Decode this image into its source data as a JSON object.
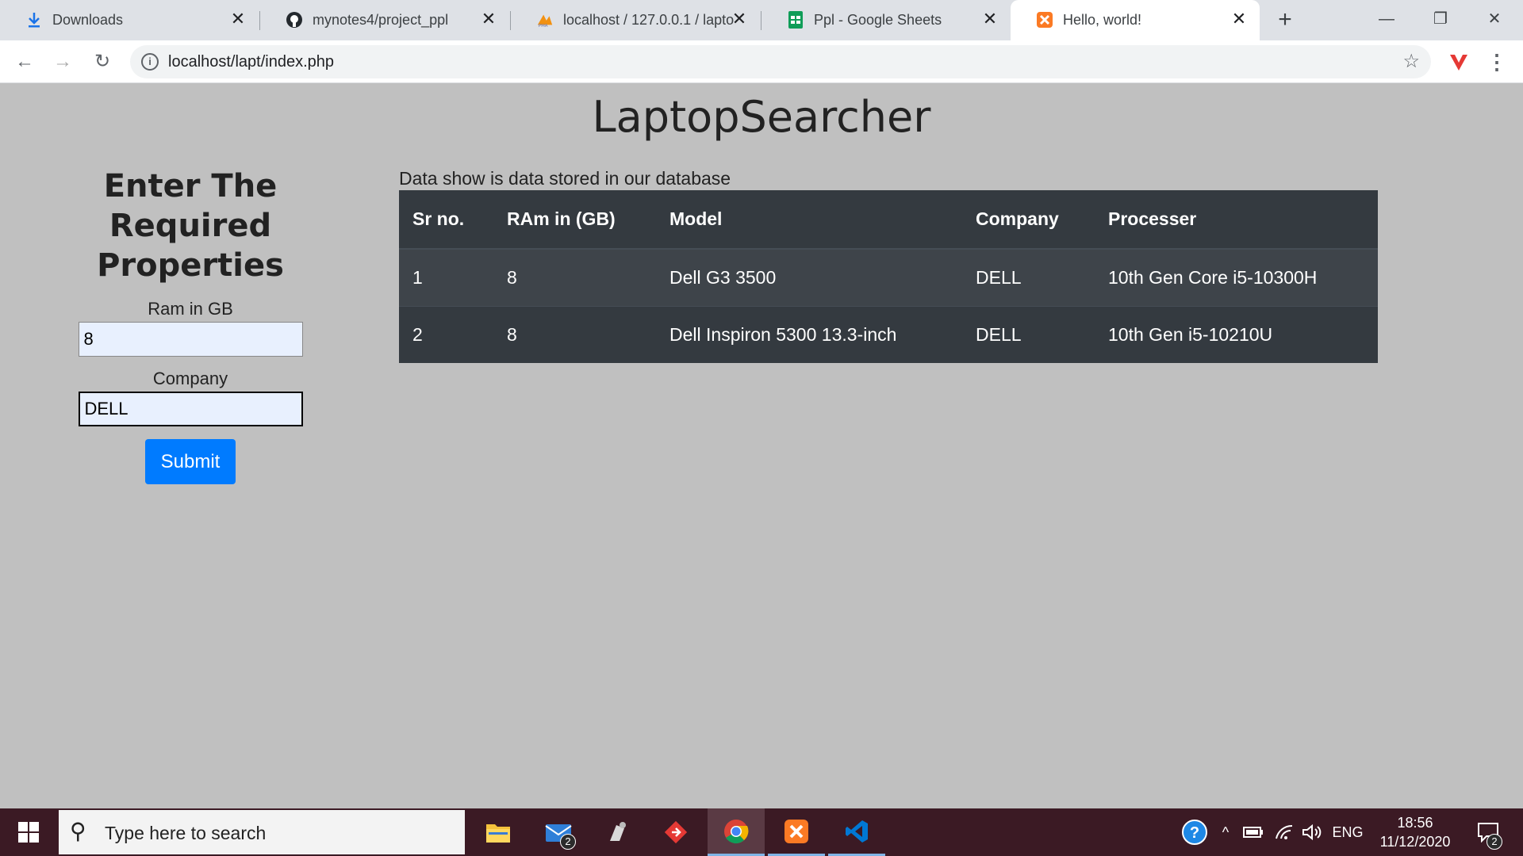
{
  "browser": {
    "tabs": [
      {
        "title": "Downloads",
        "icon": "download-icon"
      },
      {
        "title": "mynotes4/project_ppl",
        "icon": "github-icon"
      },
      {
        "title": "localhost / 127.0.0.1 / lapto",
        "icon": "phpmyadmin-icon"
      },
      {
        "title": "Ppl - Google Sheets",
        "icon": "sheets-icon"
      },
      {
        "title": "Hello, world!",
        "icon": "xampp-icon"
      }
    ],
    "address": "localhost/lapt/index.php",
    "colors": {
      "tabstrip": "#dee1e6",
      "active_tab": "#ffffff"
    }
  },
  "page": {
    "title": "LaptopSearcher",
    "form": {
      "heading": "Enter The Required Properties",
      "ram_label": "Ram in GB",
      "ram_value": "8",
      "company_label": "Company",
      "company_value": "DELL",
      "submit_label": "Submit"
    },
    "results": {
      "caption": "Data show is data stored in our database",
      "columns": [
        "Sr no.",
        "RAm in (GB)",
        "Model",
        "Company",
        "Processer"
      ],
      "rows": [
        [
          "1",
          "8",
          "Dell G3 3500",
          "DELL",
          "10th Gen Core i5-10300H"
        ],
        [
          "2",
          "8",
          "Dell Inspiron 5300 13.3-inch",
          "DELL",
          "10th Gen i5-10210U"
        ]
      ]
    },
    "colors": {
      "background": "#c0c0c0",
      "table_bg": "#343a40",
      "button": "#007bff"
    }
  },
  "taskbar": {
    "search_placeholder": "Type here to search",
    "apps": [
      "file-explorer-icon",
      "mail-icon",
      "snipping-icon",
      "git-icon",
      "chrome-icon",
      "xampp-icon",
      "vscode-icon"
    ],
    "mail_badge": "2",
    "language": "ENG",
    "time": "18:56",
    "date": "11/12/2020",
    "notification_count": "2"
  }
}
